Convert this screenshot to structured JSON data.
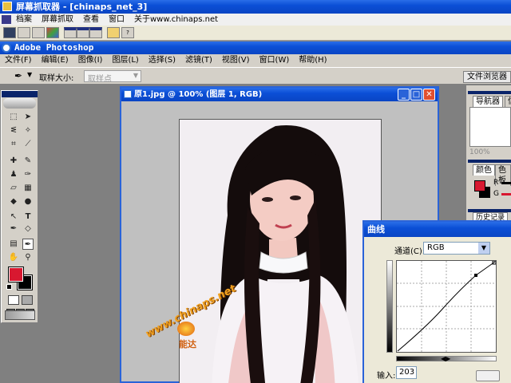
{
  "capture_app": {
    "title": "屏幕抓取器 - [chinaps_net_3]",
    "menu": [
      "档案",
      "屏幕抓取",
      "查看",
      "窗口",
      "关于www.chinaps.net"
    ],
    "toolbar_icons": [
      "save-icon",
      "print-icon",
      "copy-icon",
      "image-icon",
      "window-icon",
      "fullscreen-icon",
      "region-icon",
      "hand-icon",
      "help-icon"
    ]
  },
  "photoshop": {
    "title": "Adobe Photoshop",
    "menu": [
      "文件(F)",
      "编辑(E)",
      "图像(I)",
      "图层(L)",
      "选择(S)",
      "滤镜(T)",
      "视图(V)",
      "窗口(W)",
      "帮助(H)"
    ],
    "options_bar": {
      "sample_size_label": "取样大小:",
      "sample_size_value": "取样点",
      "file_browser_tab": "文件浏览器"
    },
    "colors": {
      "foreground": "#d81830",
      "background": "#000000"
    }
  },
  "document": {
    "title": "原1.jpg @ 100% (图层 1, RGB)",
    "watermark_text": "www.chinaps.net",
    "watermark_caption": "能达"
  },
  "panels": {
    "navigator": {
      "tabs": [
        "导航器",
        "信"
      ],
      "zoom": "100%"
    },
    "color": {
      "tabs": [
        "颜色",
        "色板"
      ],
      "channels": [
        "R",
        "G"
      ]
    },
    "history": {
      "tabs": [
        "历史记录"
      ]
    }
  },
  "curves_dialog": {
    "title": "曲线",
    "channel_label": "通道(C):",
    "channel_value": "RGB",
    "input_label": "输入:",
    "input_value": "203"
  }
}
